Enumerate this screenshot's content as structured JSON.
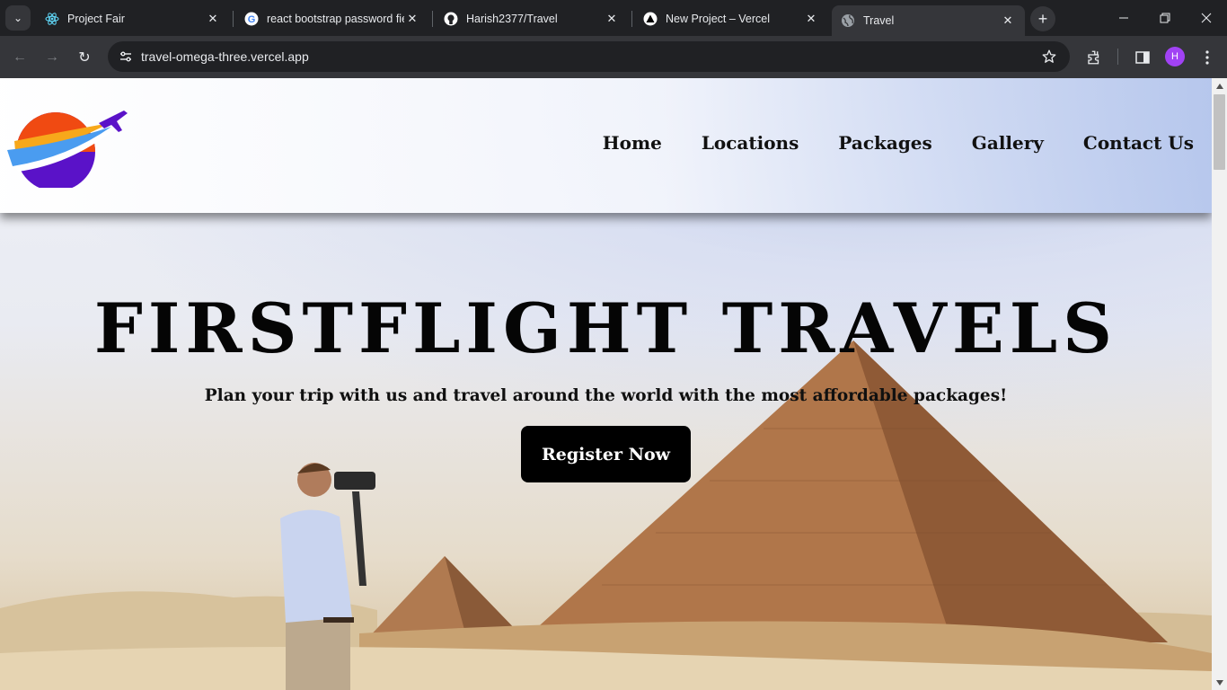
{
  "browser": {
    "tabs": [
      {
        "title": "Project Fair",
        "icon": "react-icon"
      },
      {
        "title": "react bootstrap password fie",
        "icon": "google-icon"
      },
      {
        "title": "Harish2377/Travel",
        "icon": "github-icon"
      },
      {
        "title": "New Project – Vercel",
        "icon": "vercel-icon"
      },
      {
        "title": "Travel",
        "icon": "globe-icon",
        "active": true
      }
    ],
    "url": "travel-omega-three.vercel.app",
    "profile_initial": "H"
  },
  "site": {
    "nav": [
      "Home",
      "Locations",
      "Packages",
      "Gallery",
      "Contact Us"
    ],
    "hero_title": "FIRSTFLIGHT TRAVELS",
    "hero_subtitle": "Plan your trip with us and travel around the world with the most affordable packages!",
    "cta_label": "Register Now"
  },
  "colors": {
    "chrome_dark": "#202124",
    "chrome_toolbar": "#35363a",
    "cta_background": "#000000",
    "logo_orange": "#f04a12",
    "logo_purple": "#5a12c8",
    "logo_blue": "#4a9cf0"
  }
}
